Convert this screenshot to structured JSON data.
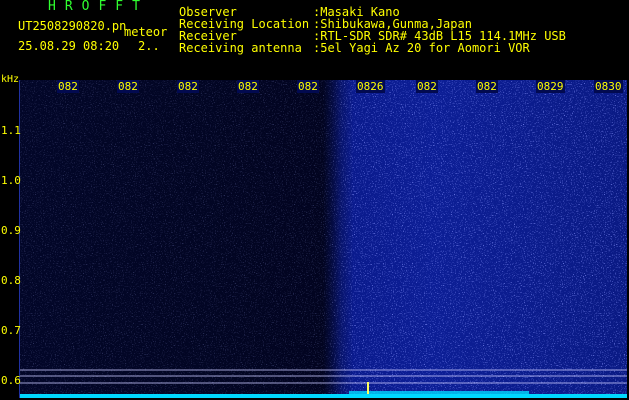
{
  "app": {
    "title": "HROFFT",
    "filename": "UT2508290820.pn",
    "file_type": "meteor",
    "datetime": "25.08.29 08:20",
    "page": "2.."
  },
  "info": {
    "labels": [
      "Observer",
      "Receiving Location",
      "Receiver",
      "Receiving antenna"
    ],
    "values": [
      ":Masaki Kano",
      ":Shibukawa,Gunma,Japan",
      ":RTL-SDR SDR# 43dB L15 114.1MHz USB",
      ":5el Yagi Az 20 for Aomori VOR"
    ]
  },
  "yaxis": {
    "unit": "kHz",
    "ticks": [
      "1.1",
      "1.0",
      "0.9",
      "0.8",
      "0.7",
      "0.6"
    ]
  },
  "xaxis": {
    "ticks": [
      "082",
      "082",
      "082",
      "082",
      "082",
      "0826",
      "082",
      "082",
      "0829",
      "0830"
    ]
  },
  "colors": {
    "text": "#ffff00",
    "title": "#30ff30",
    "background": "#000000",
    "spectrogram": "#0a1a8a",
    "noise_strip": "#00d8ff"
  }
}
